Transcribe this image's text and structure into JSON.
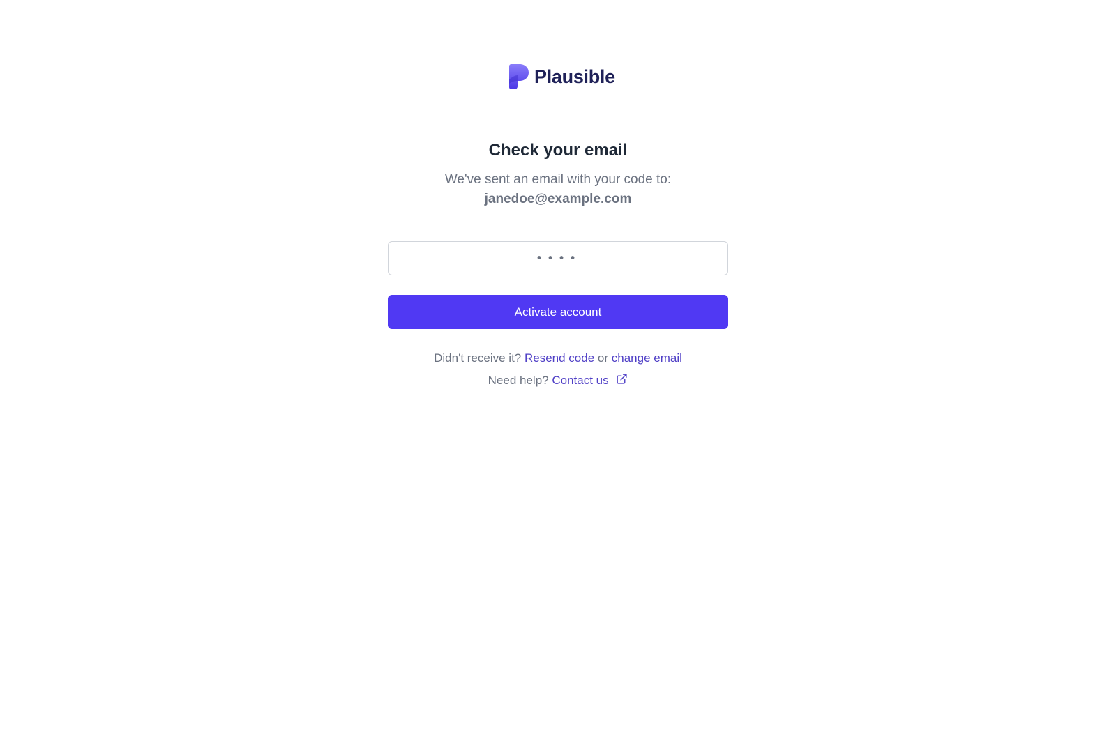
{
  "brand": {
    "name": "Plausible",
    "logo_icon": "plausible-logo-icon",
    "colors": {
      "primary": "#5039f3",
      "link": "#4f3fc6",
      "brand_text": "#1f2158"
    }
  },
  "verification": {
    "title": "Check your email",
    "subtitle": "We've sent an email with your code to:",
    "email": "janedoe@example.com",
    "code_value": "••••",
    "activate_label": "Activate account"
  },
  "footer": {
    "resend_prefix": "Didn't receive it?",
    "resend_link": "Resend code",
    "or_text": "or",
    "change_email_link": "change email",
    "help_prefix": "Need help?",
    "contact_link": "Contact us",
    "contact_icon": "external-link-icon"
  }
}
